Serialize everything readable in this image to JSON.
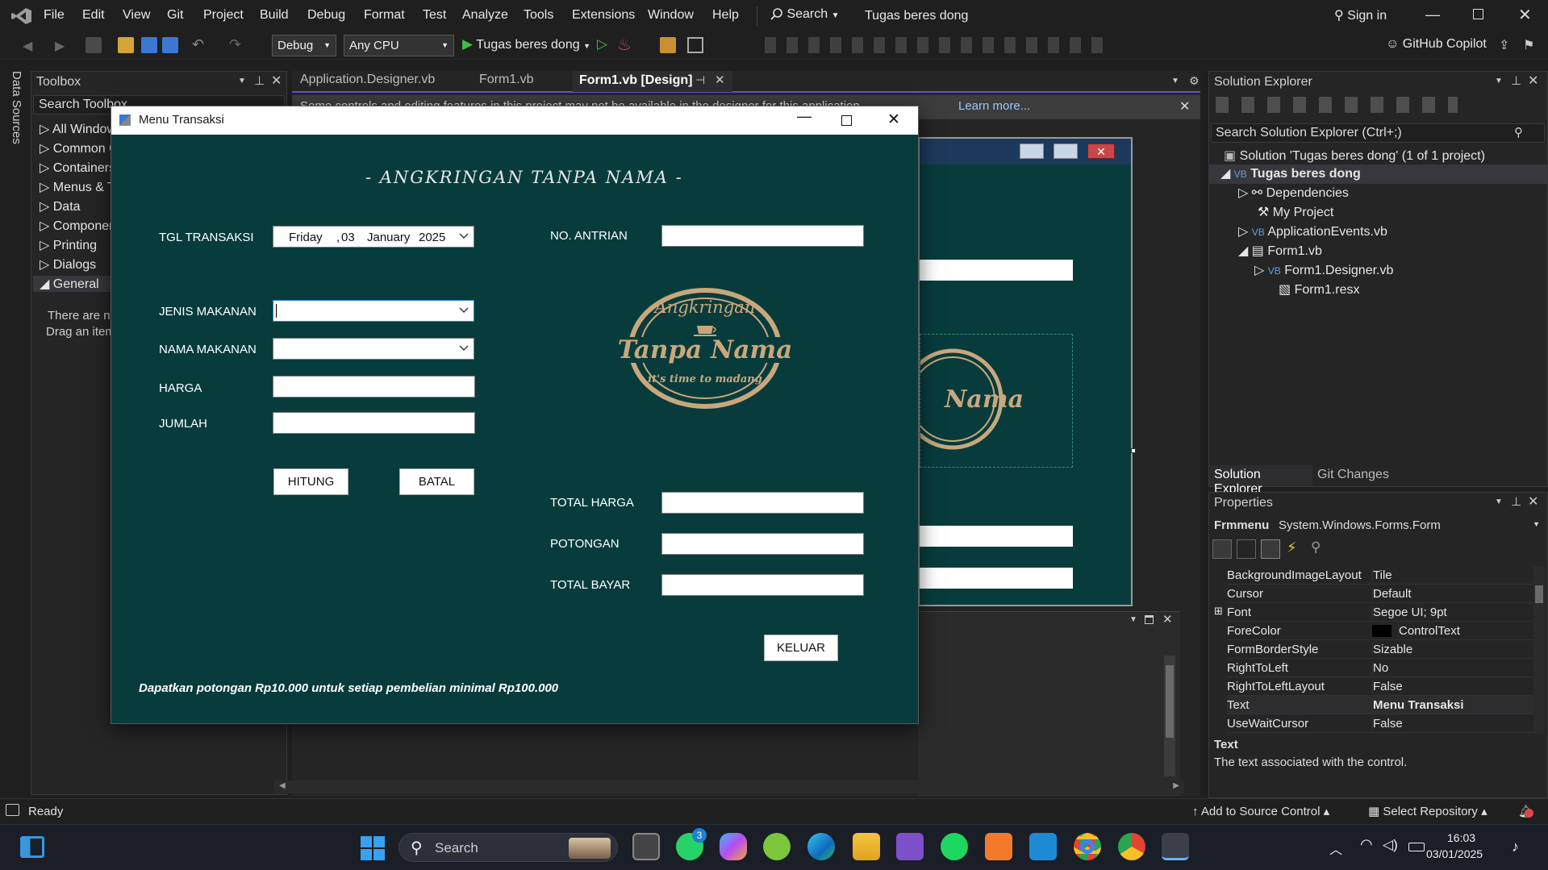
{
  "menubar": {
    "items": [
      "File",
      "Edit",
      "View",
      "Git",
      "Project",
      "Build",
      "Debug",
      "Format",
      "Test",
      "Analyze",
      "Tools",
      "Extensions",
      "Window",
      "Help"
    ],
    "search": "Search",
    "solution_title": "Tugas beres dong",
    "sign_in": "Sign in"
  },
  "toolbar": {
    "config": "Debug",
    "platform": "Any CPU",
    "run_target": "Tugas beres dong",
    "copilot": "GitHub Copilot"
  },
  "side_strip": {
    "label": "Data Sources"
  },
  "toolbox": {
    "title": "Toolbox",
    "search_placeholder": "Search Toolbox",
    "items": [
      "All Windows Forms",
      "Common Controls",
      "Containers",
      "Menus & Toolbars",
      "Data",
      "Components",
      "Printing",
      "Dialogs",
      "General"
    ],
    "empty_line1": "There are no usable controls in this group.",
    "empty_line2": "Drag an item onto this text to add it to the toolbox."
  },
  "editor": {
    "tabs": [
      "Application.Designer.vb",
      "Form1.vb",
      "Form1.vb [Design]"
    ],
    "info_bar_text": "Some controls and editing features in this project may not be available in the designer for this application.",
    "info_bar_link": "Learn more..."
  },
  "form": {
    "title": "Menu Transaksi",
    "heading": "- ANGKRINGAN TANPA NAMA -",
    "labels": {
      "tgl": "TGL TRANSAKSI",
      "antrian": "NO. ANTRIAN",
      "jenis": "JENIS MAKANAN",
      "nama": "NAMA MAKANAN",
      "harga": "HARGA",
      "jumlah": "JUMLAH",
      "total_harga": "TOTAL HARGA",
      "potongan": "POTONGAN",
      "total_bayar": "TOTAL BAYAR"
    },
    "date": {
      "day": "Friday",
      "sep": ",",
      "date": "03",
      "month": "January",
      "year": "2025"
    },
    "buttons": {
      "hitung": "HITUNG",
      "batal": "BATAL",
      "keluar": "KELUAR"
    },
    "logo": {
      "top": "Angkringan",
      "middle": "Tanpa Nama",
      "bottom": "it's time to madang"
    },
    "footer": "Dapatkan potongan Rp10.000 untuk setiap pembelian minimal Rp100.000"
  },
  "solution_explorer": {
    "title": "Solution Explorer",
    "search_placeholder": "Search Solution Explorer (Ctrl+;)",
    "tree": [
      "Solution 'Tugas beres dong' (1 of 1 project)",
      "Tugas beres dong",
      "Dependencies",
      "My Project",
      "ApplicationEvents.vb",
      "Form1.vb",
      "Form1.Designer.vb",
      "Form1.resx"
    ],
    "bottom_tabs": [
      "Solution Explorer",
      "Git Changes"
    ]
  },
  "properties": {
    "title": "Properties",
    "object_name": "Frmmenu",
    "object_type": "System.Windows.Forms.Form",
    "rows": [
      {
        "name": "BackgroundImageLayout",
        "value": "Tile"
      },
      {
        "name": "Cursor",
        "value": "Default"
      },
      {
        "name": "Font",
        "value": "Segoe UI; 9pt"
      },
      {
        "name": "ForeColor",
        "value": "ControlText"
      },
      {
        "name": "FormBorderStyle",
        "value": "Sizable"
      },
      {
        "name": "RightToLeft",
        "value": "No"
      },
      {
        "name": "RightToLeftLayout",
        "value": "False"
      },
      {
        "name": "Text",
        "value": "Menu Transaksi"
      },
      {
        "name": "UseWaitCursor",
        "value": "False"
      }
    ],
    "desc_title": "Text",
    "desc_body": "The text associated with the control."
  },
  "statusbar": {
    "status": "Ready",
    "source_control": "Add to Source Control",
    "repository": "Select Repository"
  },
  "taskbar": {
    "search": "Search",
    "time": "16:03",
    "date": "03/01/2025",
    "badge": "3"
  },
  "colors": {
    "form_bg": "#083c3c",
    "vs_bg": "#1f1f1f",
    "accent": "#6c4fc8",
    "logo_gold": "#c9a77c"
  }
}
